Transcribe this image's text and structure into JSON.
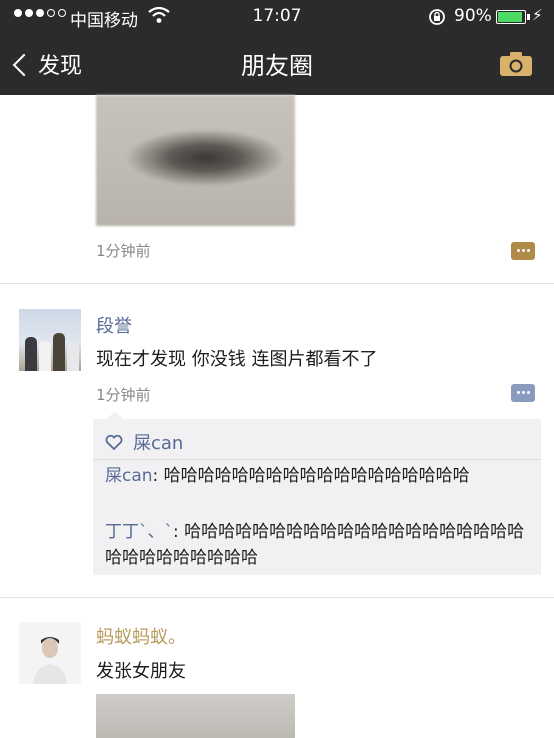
{
  "status_bar": {
    "carrier": "中国移动",
    "time": "17:07",
    "battery_percent": "90%",
    "battery_level": 0.9
  },
  "nav": {
    "back_label": "发现",
    "title": "朋友圈"
  },
  "posts": [
    {
      "time": "1分钟前"
    },
    {
      "author": "段誉",
      "text": "现在才发现 你没钱 连图片都看不了",
      "time": "1分钟前",
      "likes": "屎can",
      "comments": [
        {
          "name": "屎can",
          "text": ": 哈哈哈哈哈哈哈哈哈哈哈哈哈哈哈哈哈哈"
        },
        {
          "name": "丁丁`、`",
          "text": ": 哈哈哈哈哈哈哈哈哈哈哈哈哈哈哈哈哈哈哈哈哈哈哈哈哈哈哈哈哈"
        }
      ]
    },
    {
      "author": "蚂蚁蚂蚁。",
      "text": "发张女朋友"
    }
  ],
  "colors": {
    "nav_bg": "#2b2b2e",
    "link_blue": "#576b95",
    "author_gold": "#b79b5a",
    "comment_bg": "#f1f1f3",
    "comment_btn_gold": "#b08a48",
    "comment_btn_blue": "#8a9bbd",
    "camera_gold": "#d8b26a"
  }
}
